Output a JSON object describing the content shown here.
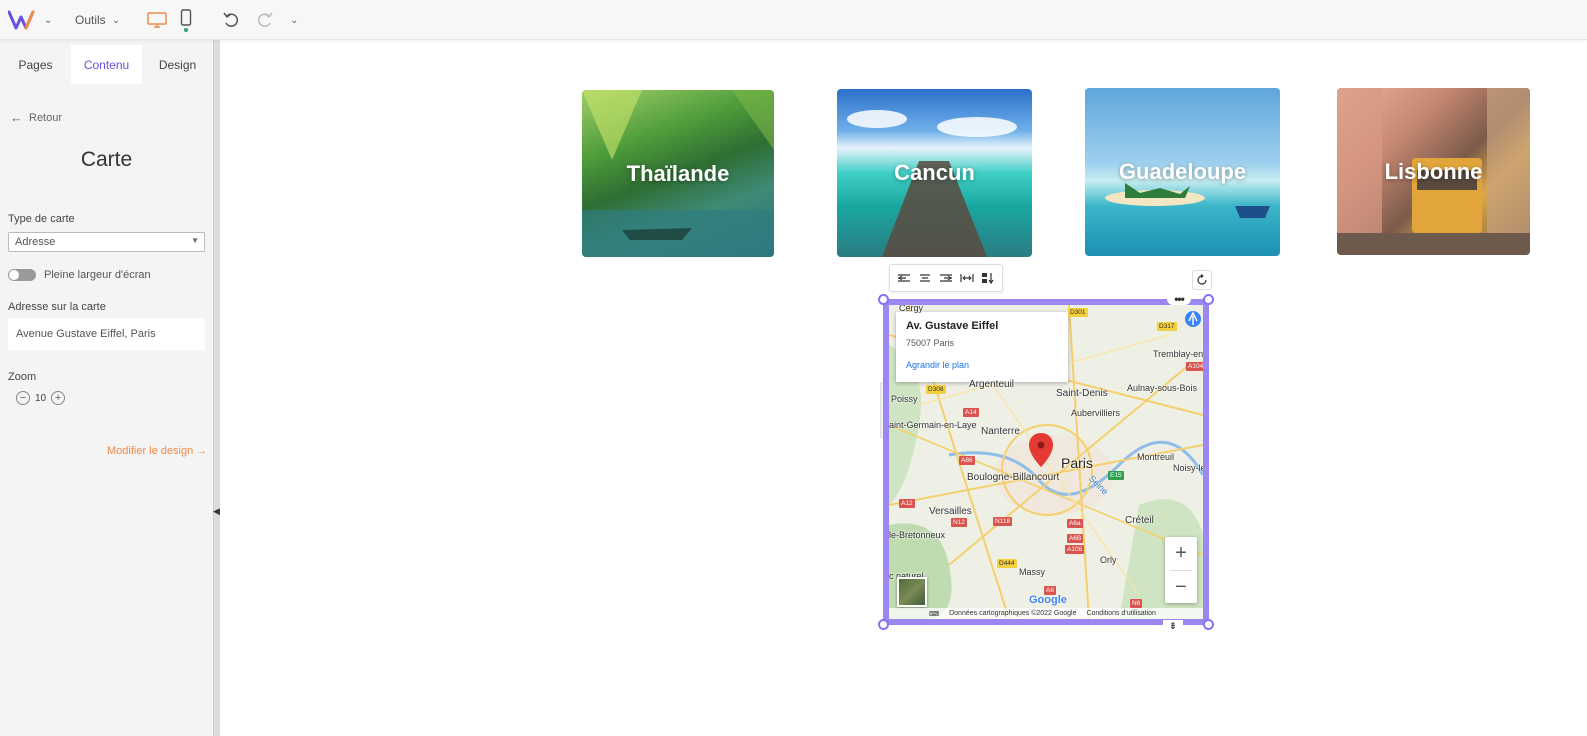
{
  "topbar": {
    "tools_label": "Outils",
    "colors": {
      "brand": "#6a4fe0",
      "device_active": "#f08a4b",
      "status_dot": "#2ea66f"
    }
  },
  "sidebar": {
    "tabs": [
      {
        "label": "Pages",
        "active": false
      },
      {
        "label": "Contenu",
        "active": true
      },
      {
        "label": "Design",
        "active": false
      }
    ],
    "back_label": "Retour",
    "title": "Carte",
    "map_type_label": "Type de carte",
    "map_type_value": "Adresse",
    "fullwidth_label": "Pleine largeur d'écran",
    "fullwidth_on": false,
    "address_label": "Adresse sur la carte",
    "address_value": "Avenue Gustave Eiffel, Paris",
    "zoom_label": "Zoom",
    "zoom_value": "10",
    "modify_link": "Modifier le design →"
  },
  "cards": [
    {
      "label": "Thaïlande"
    },
    {
      "label": "Cancun"
    },
    {
      "label": "Guadeloupe"
    },
    {
      "label": "Lisbonne"
    }
  ],
  "map": {
    "info_title": "Av. Gustave Eiffel",
    "info_subtitle": "75007 Paris",
    "info_link": "Agrandir le plan",
    "places": {
      "cergy": "Cergy",
      "poissy": "Poissy",
      "argenteuil": "Argenteuil",
      "saint_denis": "Saint-Denis",
      "aulnay": "Aulnay-sous-Bois",
      "tremblay": "Tremblay-en-",
      "aubervilliers": "Aubervilliers",
      "saint_germain": "aint-Germain-en-Laye",
      "nanterre": "Nanterre",
      "paris": "Paris",
      "montreuil": "Montreuil",
      "noisy": "Noisy-le-C",
      "boulogne": "Boulogne-Billancourt",
      "seine": "Seine",
      "versailles": "Versailles",
      "creteil": "Créteil",
      "bretonneux": "le-Bretonneux",
      "orly": "Orly",
      "massy": "Massy",
      "parc_naturel": "c naturel"
    },
    "roads": {
      "d301": "D301",
      "d317": "D317",
      "a104": "A104",
      "d308": "D308",
      "a14": "A14",
      "a86": "A86",
      "e15": "E15",
      "a12": "A12",
      "n12": "N12",
      "n118": "N118",
      "a6a": "A6a",
      "a6b": "A6B",
      "a106": "A106",
      "d444": "D444",
      "a6": "A6",
      "n6": "N6"
    },
    "google": "Google",
    "footer_data": "Données cartographiques ©2022 Google",
    "footer_terms": "Conditions d'utilisation"
  }
}
